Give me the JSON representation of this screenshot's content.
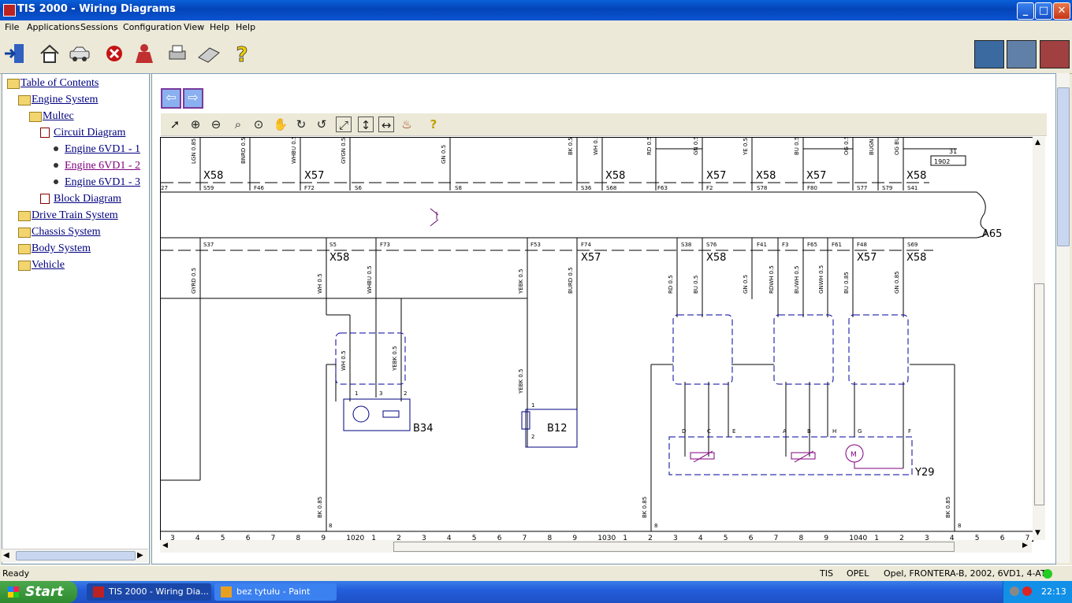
{
  "window": {
    "title": "TIS 2000 - Wiring Diagrams"
  },
  "menu": [
    "File",
    "Applications",
    "Sessions",
    "Configuration",
    "View",
    "Help",
    "Help"
  ],
  "toolbar": {
    "left_icons": [
      "exit-icon",
      "home-icon",
      "vehicle-icon",
      "stop-icon",
      "user-icon",
      "print-icon",
      "keyboard-icon",
      "help-icon"
    ],
    "right_icons": [
      "vehicle-list-icon",
      "car-side-icon",
      "car-front-icon"
    ]
  },
  "tree": {
    "toc": "Table of Contents",
    "engine_system": "Engine System",
    "multec": "Multec",
    "circuit_diagram": "Circuit Diagram",
    "engine1": "Engine 6VD1 - 1",
    "engine2": "Engine 6VD1 - 2",
    "engine3": "Engine 6VD1 - 3",
    "block_diagram": "Block Diagram",
    "drive_train": "Drive Train System",
    "chassis": "Chassis System",
    "body": "Body System",
    "vehicle": "Vehicle"
  },
  "diagram_toolbar": [
    "select-icon",
    "zoom-in-icon",
    "zoom-out-icon",
    "zoom-icon",
    "zoom-area-icon",
    "pan-hand-icon",
    "rotate-right-icon",
    "rotate-left-icon",
    "fit-window-icon",
    "fit-height-icon",
    "fit-width-icon",
    "fire-icon",
    "help-icon"
  ],
  "diagram": {
    "top_wires": [
      "LGN 0.85",
      "BNRD 0.5",
      "WHBU 0.5",
      "GYGN 0.5",
      "GN 0.5",
      "BK 0.5",
      "WH 0.5",
      "RD 0.5",
      "GN 0.5",
      "YE 0.5",
      "BU 0.5",
      "OG 0.5",
      "BUGN",
      "OG BU"
    ],
    "top_connectors": [
      "X58",
      "X57",
      "X58",
      "X57",
      "X58",
      "X57",
      "X58"
    ],
    "top_pins": [
      "27",
      "S59",
      "F46",
      "F72",
      "S6",
      "S8",
      "S36",
      "S68",
      "F63",
      "F2",
      "S78",
      "F80",
      "S77",
      "S79",
      "S41"
    ],
    "ground_ref": "31",
    "ground_box": "1902",
    "module": "A65",
    "bottom_pins": [
      "S37",
      "S5",
      "F73",
      "F53",
      "F74",
      "S38",
      "S76",
      "F41",
      "F3",
      "F65",
      "F61",
      "F48",
      "S69"
    ],
    "bottom_connectors": [
      "X58",
      "X57",
      "X58",
      "X57",
      "X58"
    ],
    "bottom_wires": [
      "GYRD 0.5",
      "WH 0.5",
      "WHBU 0.5",
      "YEBK 0.5",
      "BURD 0.5",
      "RD 0.5",
      "BU 0.5",
      "GN 0.5",
      "RDWH 0.5",
      "BUWH 0.5",
      "GNWH 0.5",
      "BU 0.85",
      "GN 0.85"
    ],
    "component_wires": [
      "WH 0.5",
      "YEBK 0.5",
      "YEBK 0.5"
    ],
    "ground_wires": [
      "BK 0.85",
      "BK 0.85",
      "BK 0.85"
    ],
    "components": [
      "B34",
      "B12",
      "Y29"
    ],
    "b34_pins": [
      "1",
      "3",
      "2"
    ],
    "b12_pins": [
      "1",
      "2"
    ],
    "y29_pins": [
      "D",
      "C",
      "E",
      "A",
      "B",
      "H",
      "G",
      "F"
    ],
    "motor_label": "M",
    "ground_pin": "8",
    "ruler": [
      "3",
      "4",
      "5",
      "6",
      "7",
      "8",
      "9",
      "1020",
      "1",
      "2",
      "3",
      "4",
      "5",
      "6",
      "7",
      "8",
      "9",
      "1030",
      "1",
      "2",
      "3",
      "4",
      "5",
      "6",
      "7",
      "8",
      "9",
      "1040",
      "1",
      "2",
      "3",
      "4",
      "5",
      "6",
      "7"
    ]
  },
  "status": {
    "ready": "Ready",
    "tis": "TIS",
    "make": "OPEL",
    "vehicle": "Opel, FRONTERA-B, 2002, 6VD1, 4-AT"
  },
  "taskbar": {
    "start": "Start",
    "task1": "TIS 2000 - Wiring Dia...",
    "task2": "bez tytułu - Paint",
    "clock": "22:13"
  },
  "colors": {
    "wire": "#000000",
    "component": "#000080",
    "dashed_box": "#0000a0",
    "purple": "#800080",
    "title_bar": "#0a5fd8",
    "taskbar": "#245edb",
    "start": "#3c9a3c"
  }
}
